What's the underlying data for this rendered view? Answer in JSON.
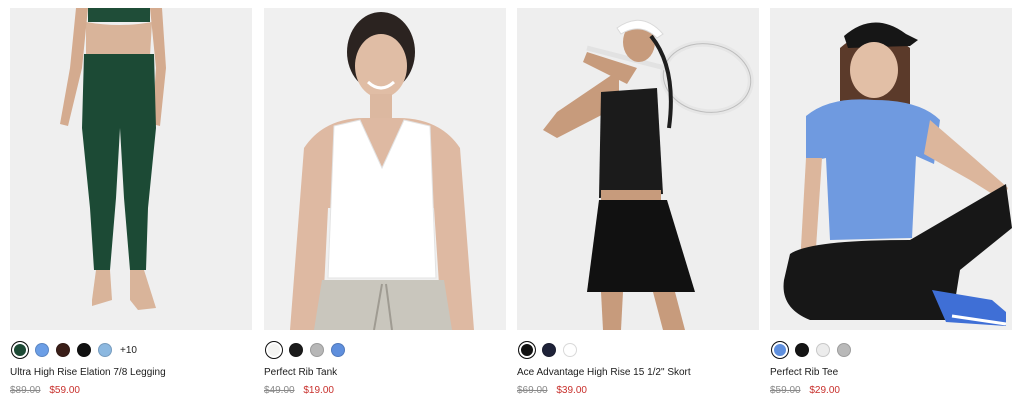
{
  "products": [
    {
      "name": "Ultra High Rise Elation 7/8 Legging",
      "original_price": "$89.00",
      "sale_price": "$59.00",
      "swatches": [
        "#1d4a35",
        "#6b9ee6",
        "#3a1e18",
        "#111111",
        "#8cb8e0"
      ],
      "more_colors": "+10"
    },
    {
      "name": "Perfect Rib Tank",
      "original_price": "$49.00",
      "sale_price": "$19.00",
      "swatches": [
        "#f4f4f2",
        "#1b1b1b",
        "#b7b7b7",
        "#5f8fdd"
      ]
    },
    {
      "name": "Ace Advantage High Rise 15 1/2\" Skort",
      "original_price": "$69.00",
      "sale_price": "$39.00",
      "swatches": [
        "#111111",
        "#1e2238",
        "#ffffff"
      ]
    },
    {
      "name": "Perfect Rib Tee",
      "original_price": "$59.00",
      "sale_price": "$29.00",
      "swatches": [
        "#5f8fdd",
        "#151515",
        "#ececec",
        "#b9b9b9"
      ]
    }
  ]
}
